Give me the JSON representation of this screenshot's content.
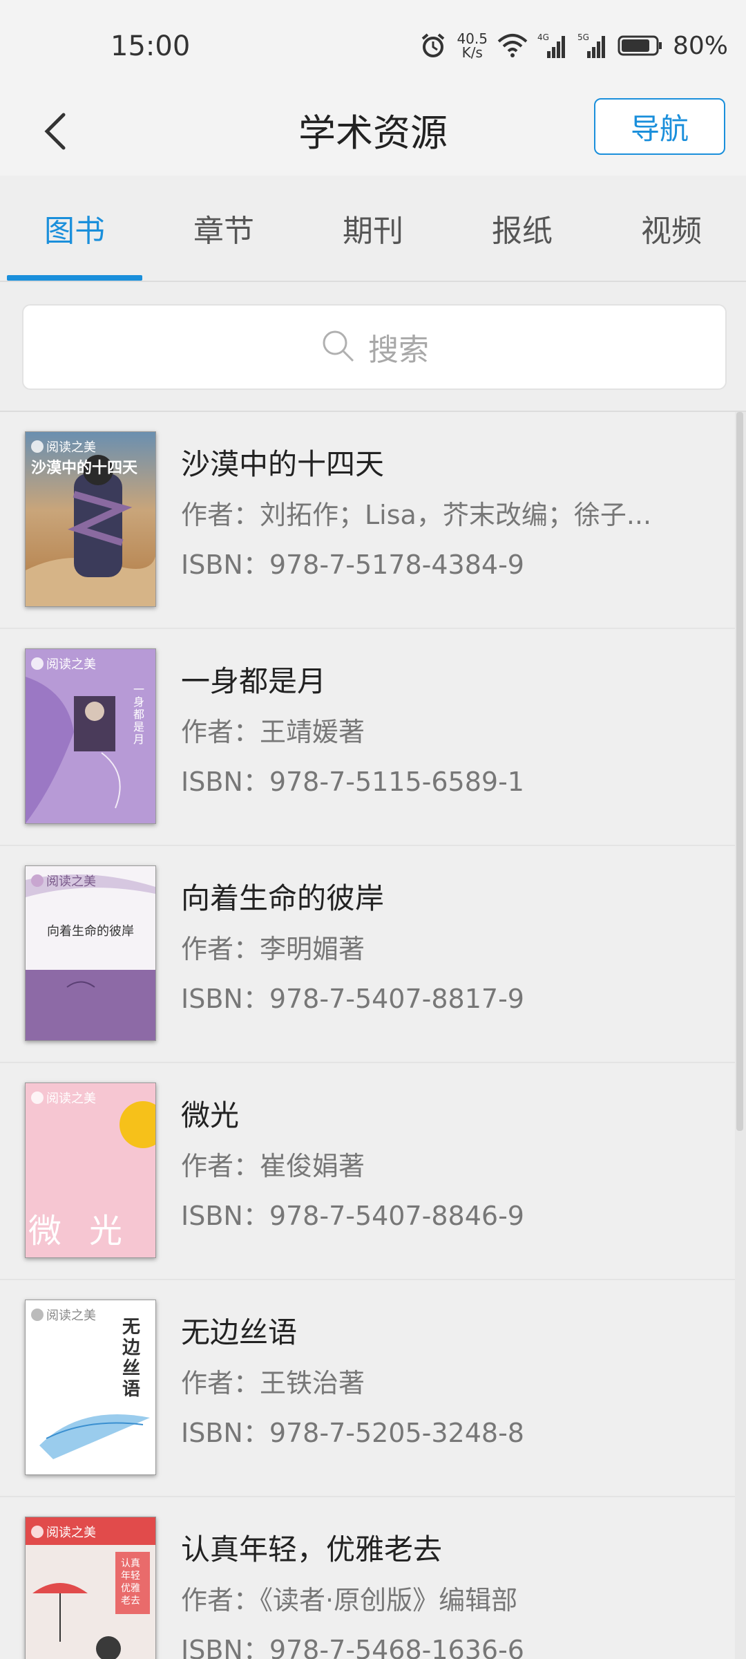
{
  "status_bar": {
    "time": "15:00",
    "net_speed_value": "40.5",
    "net_speed_unit": "K/s",
    "battery": "80%",
    "icons": [
      "alarm-icon",
      "wifi-icon",
      "signal-4g-icon",
      "signal-5g-icon",
      "battery-icon"
    ]
  },
  "header": {
    "title": "学术资源",
    "nav_button": "导航"
  },
  "tabs": [
    {
      "label": "图书",
      "active": true
    },
    {
      "label": "章节",
      "active": false
    },
    {
      "label": "期刊",
      "active": false
    },
    {
      "label": "报纸",
      "active": false
    },
    {
      "label": "视频",
      "active": false
    }
  ],
  "search": {
    "placeholder": "搜索"
  },
  "books": [
    {
      "title": "沙漠中的十四天",
      "author": "作者：刘拓作；Lisa，芥末改编；徐子...",
      "isbn": "ISBN：978-7-5178-4384-9",
      "cover_logo": "阅读之美",
      "cover_text": "沙漠中的十四天"
    },
    {
      "title": "一身都是月",
      "author": "作者：王靖媛著",
      "isbn": "ISBN：978-7-5115-6589-1",
      "cover_logo": "阅读之美",
      "cover_text": "一身都是月"
    },
    {
      "title": "向着生命的彼岸",
      "author": "作者：李明媚著",
      "isbn": "ISBN：978-7-5407-8817-9",
      "cover_logo": "阅读之美",
      "cover_text": "向着生命的彼岸"
    },
    {
      "title": "微光",
      "author": "作者：崔俊娟著",
      "isbn": "ISBN：978-7-5407-8846-9",
      "cover_logo": "阅读之美",
      "cover_text": "微光"
    },
    {
      "title": "无边丝语",
      "author": "作者：王铁治著",
      "isbn": "ISBN：978-7-5205-3248-8",
      "cover_logo": "阅读之美",
      "cover_text": "无边丝语"
    },
    {
      "title": "认真年轻，优雅老去",
      "author": "作者：《读者·原创版》编辑部",
      "isbn": "ISBN：978-7-5468-1636-6",
      "cover_logo": "阅读之美",
      "cover_text": "认真年轻 优雅老去"
    }
  ],
  "colors": {
    "accent": "#1a8fdb",
    "background": "#efefef"
  }
}
